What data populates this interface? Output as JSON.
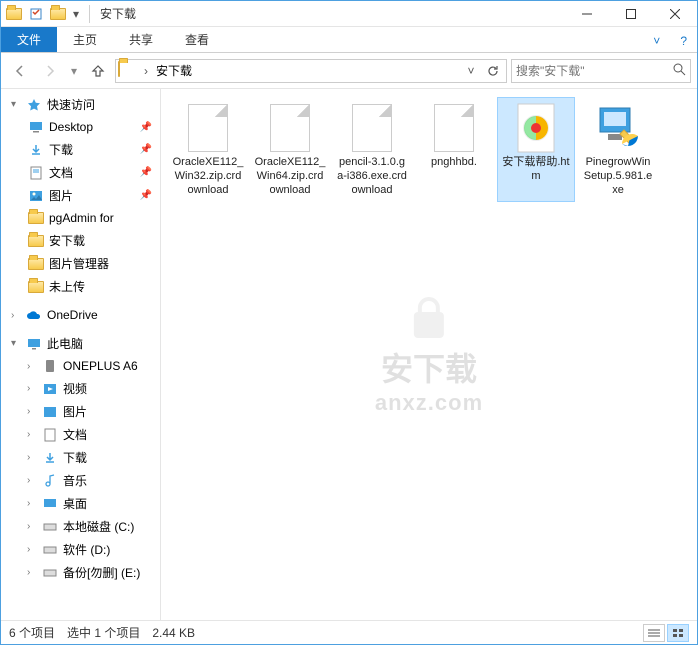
{
  "window": {
    "title": "安下载"
  },
  "ribbon": {
    "file": "文件",
    "home": "主页",
    "share": "共享",
    "view": "查看"
  },
  "address": {
    "crumb": "安下载"
  },
  "search": {
    "placeholder": "搜索\"安下载\""
  },
  "nav": {
    "quick": "快速访问",
    "desktop": "Desktop",
    "downloads": "下载",
    "documents": "文档",
    "pictures": "图片",
    "pgadmin": "pgAdmin for",
    "anxz": "安下载",
    "picmgr": "图片管理器",
    "unsent": "未上传",
    "onedrive": "OneDrive",
    "thispc": "此电脑",
    "oneplus": "ONEPLUS A6",
    "videos": "视频",
    "pictures2": "图片",
    "documents2": "文档",
    "downloads2": "下载",
    "music": "音乐",
    "desktop2": "桌面",
    "diskc": "本地磁盘 (C:)",
    "diskd": "软件 (D:)",
    "diske": "备份[勿删] (E:)"
  },
  "files": [
    {
      "name": "OracleXE112_Win32.zip.crdownload",
      "type": "file"
    },
    {
      "name": "OracleXE112_Win64.zip.crdownload",
      "type": "file"
    },
    {
      "name": "pencil-3.1.0.ga-i386.exe.crdownload",
      "type": "file"
    },
    {
      "name": "pnghhbd.",
      "type": "file"
    },
    {
      "name": "安下载帮助.htm",
      "type": "htm",
      "selected": true
    },
    {
      "name": "PinegrowWinSetup.5.981.exe",
      "type": "exe"
    }
  ],
  "status": {
    "count": "6 个项目",
    "selection": "选中 1 个项目",
    "size": "2.44 KB"
  },
  "watermark": {
    "cn": "安下载",
    "en": "anxz.com"
  }
}
